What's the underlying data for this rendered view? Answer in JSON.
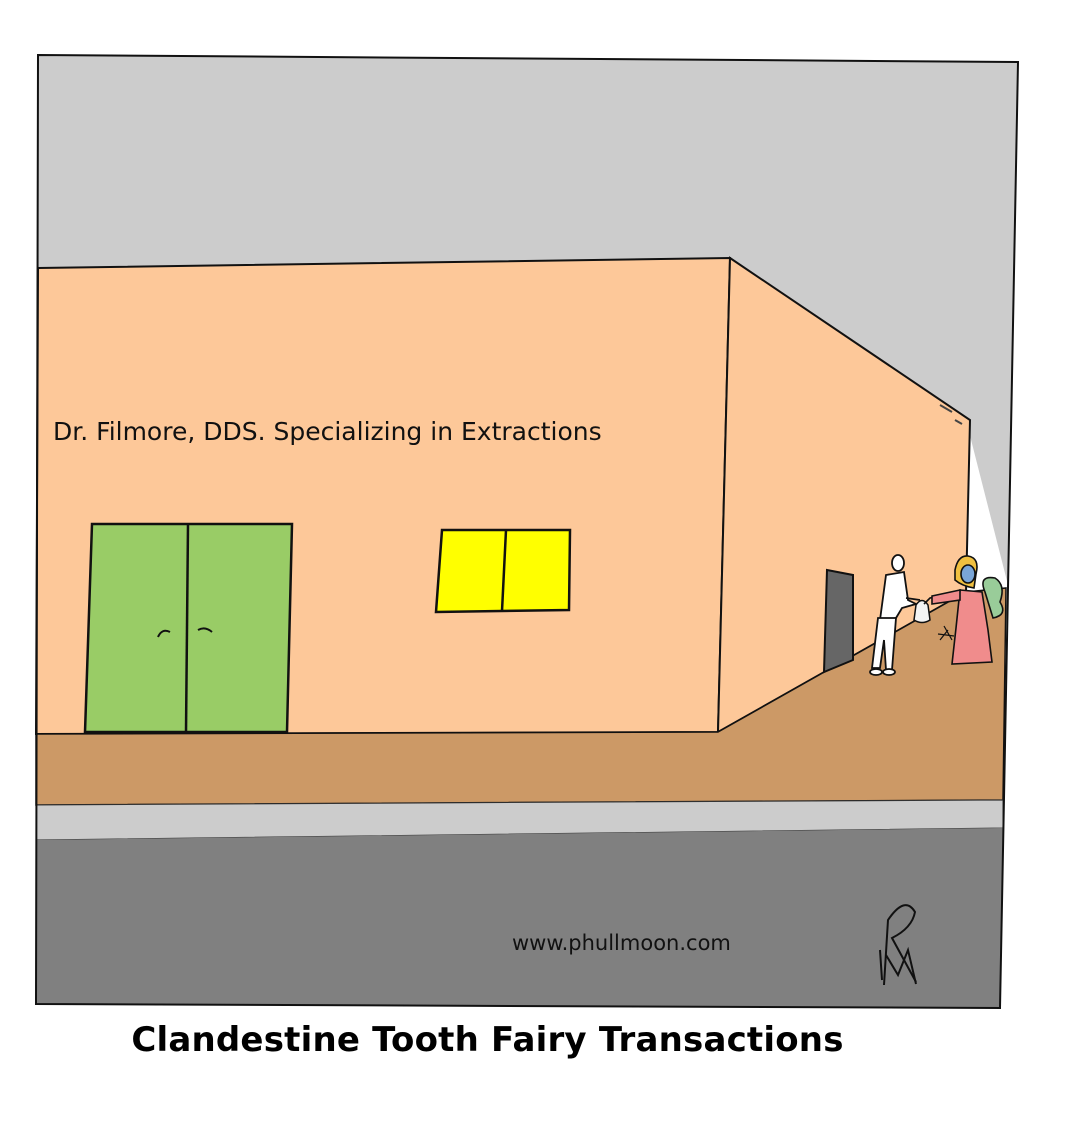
{
  "cartoon": {
    "sign_text": "Dr. Filmore, DDS. Specializing in Extractions",
    "website": "www.phullmoon.com",
    "signature": "PM",
    "caption": "Clandestine Tooth Fairy Transactions"
  },
  "colors": {
    "sky": "#cccccc",
    "building_wall": "#fdc899",
    "sidewalk": "#cc9966",
    "curb": "#cccccc",
    "street": "#808080",
    "door": "#99cc66",
    "window": "#ffff00",
    "fairy_dress": "#f08c8c",
    "fairy_hair": "#f0c040",
    "fairy_wings": "#99cc99",
    "dentist_coat": "#ffffff"
  }
}
